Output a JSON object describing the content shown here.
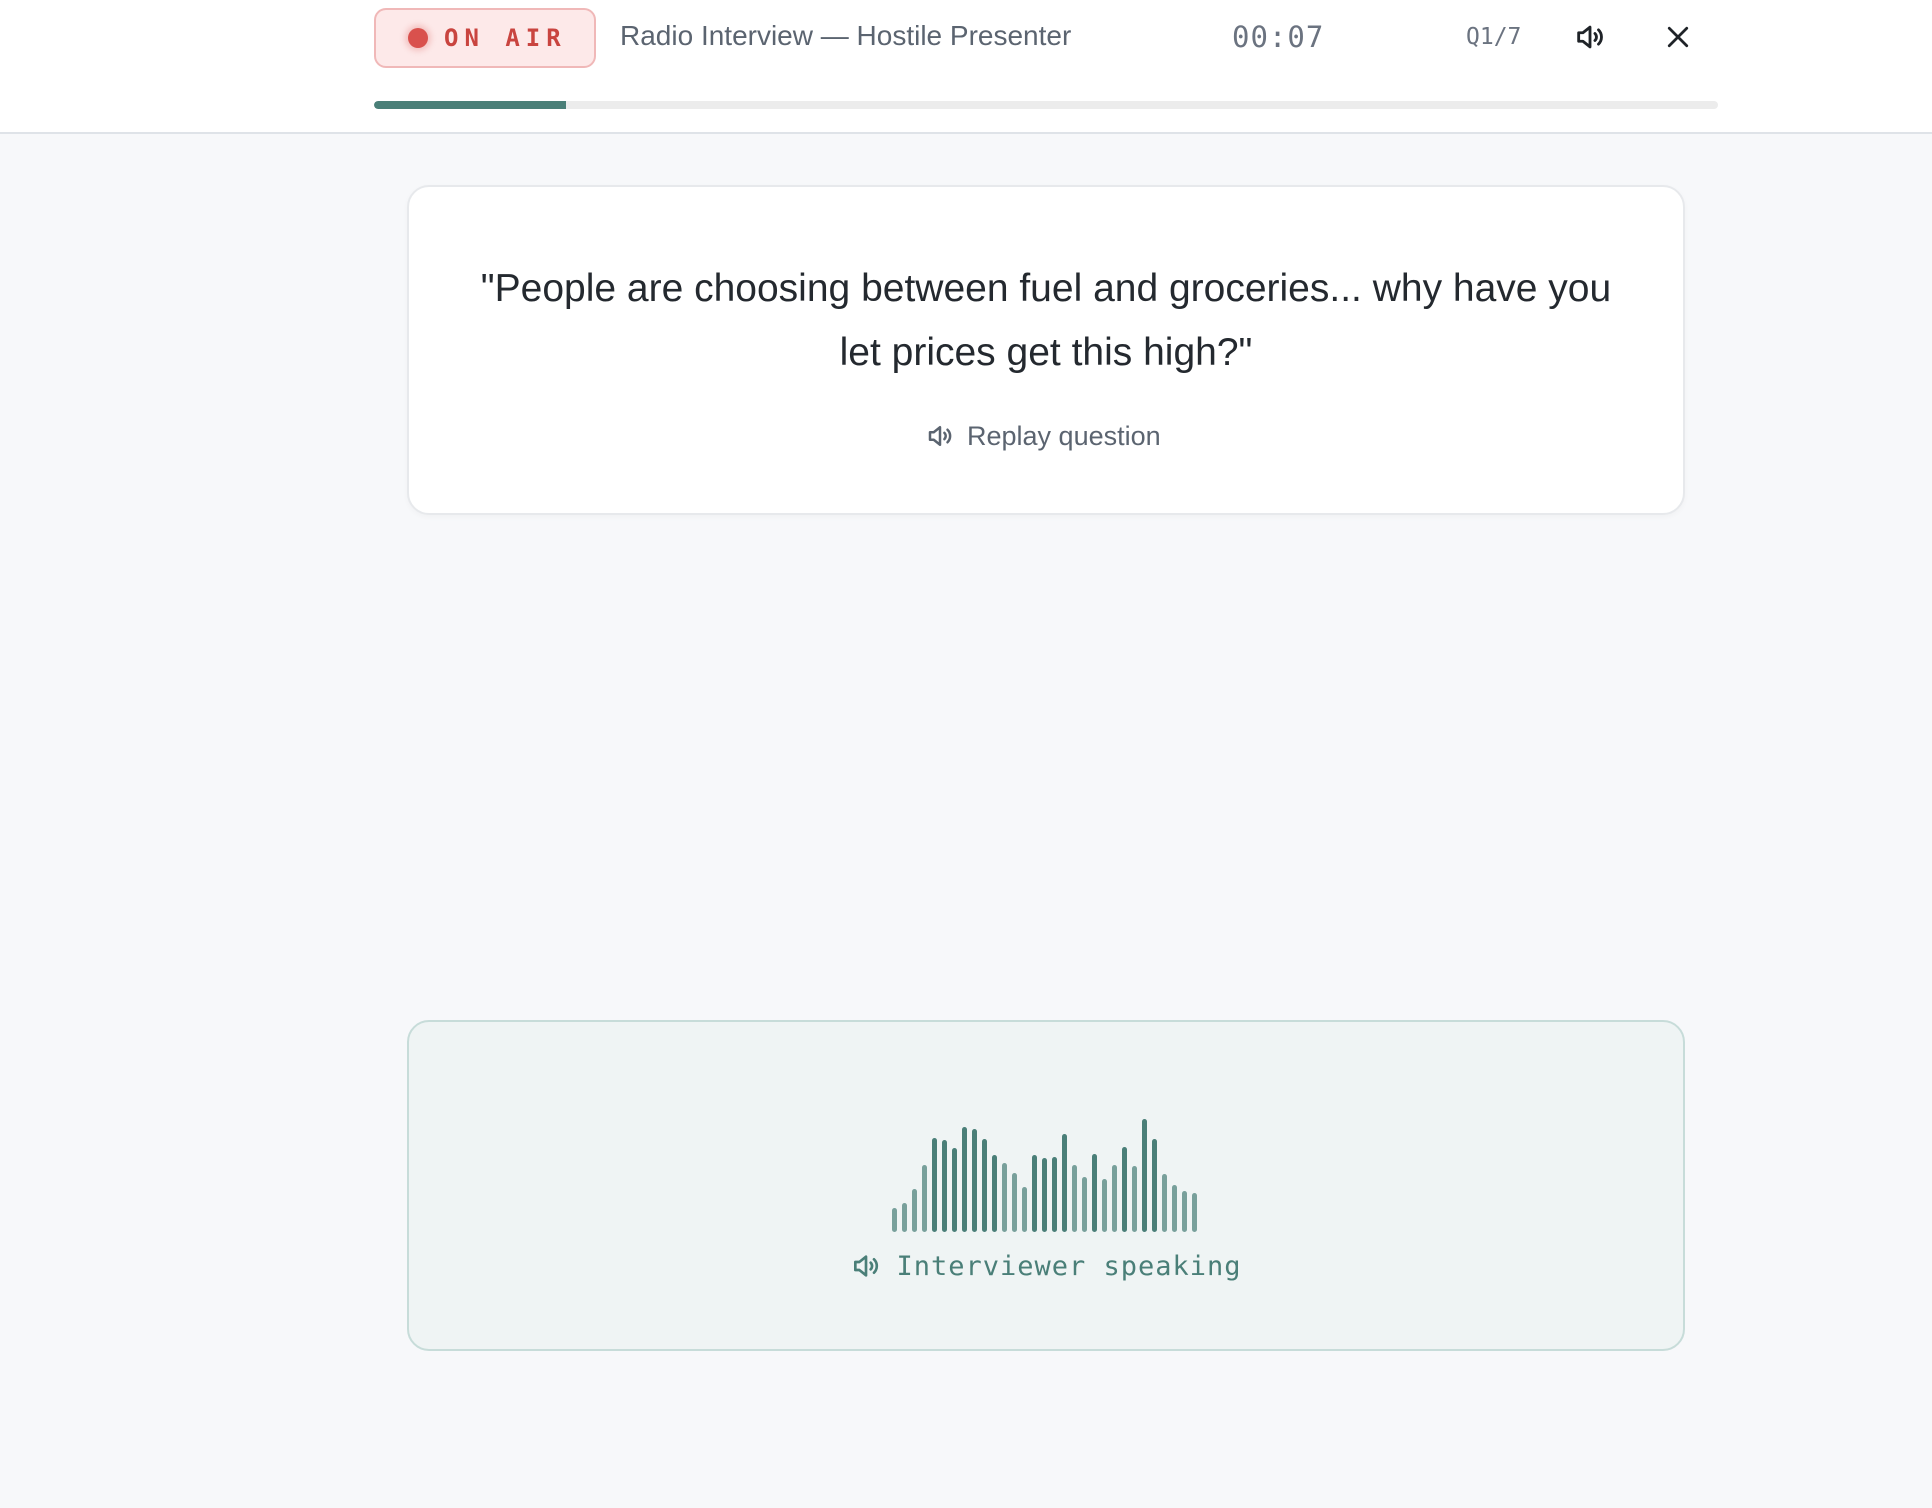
{
  "header": {
    "on_air_label": "ON AIR",
    "title": "Radio Interview — Hostile Presenter",
    "timer": "00:07",
    "question_counter": "Q1/7",
    "progress_fraction": 0.143
  },
  "question": {
    "text": "\"People are choosing between fuel and groceries... why have you let prices get this high?\"",
    "replay_label": "Replay question"
  },
  "speaker": {
    "status_label": "Interviewer speaking",
    "waveform_levels": [
      0.24,
      0.29,
      0.43,
      0.67,
      0.94,
      0.92,
      0.84,
      1.05,
      1.03,
      0.93,
      0.77,
      0.69,
      0.59,
      0.45,
      0.77,
      0.74,
      0.75,
      0.98,
      0.67,
      0.55,
      0.78,
      0.53,
      0.67,
      0.85,
      0.66,
      1.13,
      0.93,
      0.58,
      0.47,
      0.41,
      0.39
    ]
  },
  "colors": {
    "accent": "#4a7f78",
    "on_air_red": "#c9443f"
  }
}
